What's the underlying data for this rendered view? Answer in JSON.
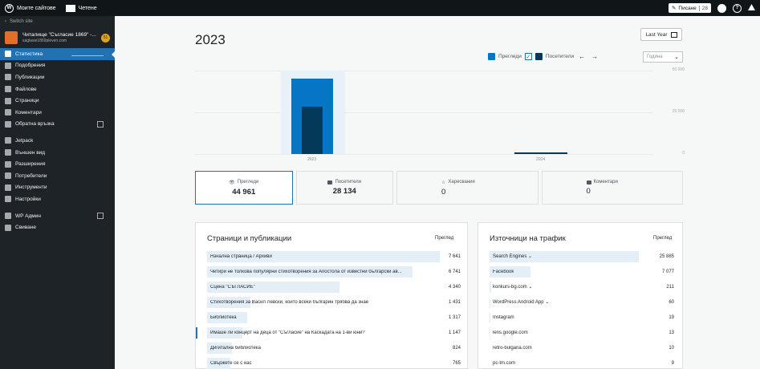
{
  "topbar": {
    "my_sites": "Моите сайтове",
    "reader": "Четене",
    "write": "Писане",
    "write_count": "28",
    "wp_logo": "W",
    "help": "?"
  },
  "sidebar": {
    "switch_site": "Switch site",
    "site_name": "Читалище \"Съгласие 1869\" -...",
    "site_url": "saglasie1869pleven.com",
    "site_badge": "51",
    "items": [
      {
        "label": "Статистика",
        "icon": "stats-icon"
      },
      {
        "label": "Подобрения",
        "icon": "cart-icon"
      },
      {
        "label": "Публикации",
        "icon": "pin-icon"
      },
      {
        "label": "Файлове",
        "icon": "media-icon"
      },
      {
        "label": "Страници",
        "icon": "page-icon"
      },
      {
        "label": "Коментари",
        "icon": "comment-icon"
      },
      {
        "label": "Обратна връзка",
        "icon": "feedback-icon"
      }
    ],
    "items2": [
      {
        "label": "Jetpack",
        "icon": "jetpack-icon"
      },
      {
        "label": "Външен вид",
        "icon": "brush-icon"
      },
      {
        "label": "Разширения",
        "icon": "plugin-icon"
      },
      {
        "label": "Потребители",
        "icon": "users-icon"
      },
      {
        "label": "Инструменти",
        "icon": "tools-icon"
      },
      {
        "label": "Настройки",
        "icon": "settings-icon"
      }
    ],
    "items3": [
      {
        "label": "WP Админ",
        "icon": "wp-icon"
      },
      {
        "label": "Свиване",
        "icon": "collapse-icon"
      }
    ]
  },
  "header": {
    "year": "2023",
    "period_button": "Last Year",
    "legend_views": "Прегледи",
    "legend_visitors": "Посетители",
    "interval_placeholder": "Година",
    "prev_arrow": "←",
    "next_arrow": "→",
    "check": "✓"
  },
  "colors": {
    "views": "#0675c4",
    "visitors": "#043959",
    "accent": "#2271b1"
  },
  "chart_data": {
    "type": "bar",
    "categories": [
      "2023",
      "2024"
    ],
    "series": [
      {
        "name": "Прегледи",
        "values": [
          44961,
          800
        ]
      },
      {
        "name": "Посетители",
        "values": [
          28134,
          500
        ]
      }
    ],
    "ylim": [
      0,
      50000
    ],
    "yticks": [
      "50 000",
      "25 000",
      "0"
    ]
  },
  "summary": [
    {
      "label": "Прегледи",
      "value": "44 961"
    },
    {
      "label": "Посетители",
      "value": "28 134"
    },
    {
      "label": "Харесвания",
      "value": "0"
    },
    {
      "label": "Коментари",
      "value": "0"
    }
  ],
  "posts": {
    "title": "Страници и публикации",
    "col_header": "Преглед",
    "rows": [
      {
        "label": "Начална страница / Архиви",
        "value": "7 641",
        "n": 7641
      },
      {
        "label": "Четири не толкова популярни стихотворения за Апостола от известни български ав...",
        "value": "6 741",
        "n": 6741
      },
      {
        "label": "Сцена \"СЪГЛАСИЕ\"",
        "value": "4 340",
        "n": 4340
      },
      {
        "label": "Стихотворения за Васил Левски, които всеки българин трябва да знае",
        "value": "1 431",
        "n": 1431
      },
      {
        "label": "Библиотека",
        "value": "1 317",
        "n": 1317
      },
      {
        "label": "Имаше ли концерт на деца от \"Съгласие\" на Каскадата на 1-ви юни?",
        "value": "1 147",
        "n": 1147
      },
      {
        "label": "Дигитална библиотека",
        "value": "824",
        "n": 824
      },
      {
        "label": "Свържете се с нас",
        "value": "765",
        "n": 765
      }
    ]
  },
  "referrers": {
    "title": "Източници на трафик",
    "col_header": "Преглед",
    "rows": [
      {
        "label": "Search Engines ⌄",
        "value": "25 885",
        "n": 25885
      },
      {
        "label": "Facebook",
        "value": "7 077",
        "n": 7077
      },
      {
        "label": "konkurs-bg.com ⌄",
        "value": "211",
        "n": 211
      },
      {
        "label": "WordPress Android App ⌄",
        "value": "60",
        "n": 60
      },
      {
        "label": "Instagram",
        "value": "19",
        "n": 19
      },
      {
        "label": "lens.google.com",
        "value": "13",
        "n": 13
      },
      {
        "label": "retro-bulgaria.com",
        "value": "10",
        "n": 10
      },
      {
        "label": "pc-tm.com",
        "value": "9",
        "n": 9
      }
    ]
  }
}
